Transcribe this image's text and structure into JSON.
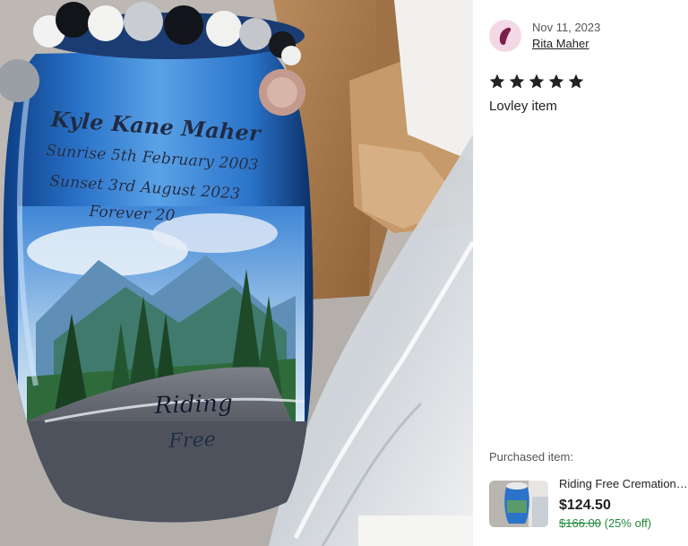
{
  "photo": {
    "urn_engraving": {
      "name": "Kyle Kane Maher",
      "line1": "Sunrise 5th February 2003",
      "line2": "Sunset 3rd August 2023",
      "line3": "Forever 20",
      "design_text_1": "Riding",
      "design_text_2": "Free"
    }
  },
  "review": {
    "date": "Nov 11, 2023",
    "reviewer_name": "Rita Maher",
    "rating": 5,
    "rating_max": 5,
    "text": "Lovley item"
  },
  "purchased": {
    "label": "Purchased item:",
    "title": "Riding Free Cremation Urn",
    "price": "$124.50",
    "original_price": "$166.00",
    "discount": "(25% off)"
  },
  "colors": {
    "star": "#222222",
    "discount_green": "#1f8a3a",
    "avatar_bg": "#f4d8e5",
    "avatar_glyph": "#7a1f4a",
    "urn_blue": "#2a73c9"
  },
  "icons": {
    "avatar": "reviewer-avatar-icon",
    "star": "star-icon"
  }
}
